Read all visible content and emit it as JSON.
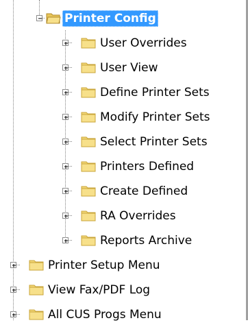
{
  "tree": {
    "selected": {
      "label": "Printer Config",
      "icon": "folder-open-icon",
      "expander": "minus"
    },
    "children": [
      {
        "label": "User Overrides",
        "icon": "folder-icon",
        "expander": "plus"
      },
      {
        "label": "User View",
        "icon": "folder-icon",
        "expander": "plus"
      },
      {
        "label": "Define Printer Sets",
        "icon": "folder-icon",
        "expander": "plus"
      },
      {
        "label": "Modify Printer Sets",
        "icon": "folder-icon",
        "expander": "plus"
      },
      {
        "label": "Select Printer Sets",
        "icon": "folder-icon",
        "expander": "plus"
      },
      {
        "label": "Printers Defined",
        "icon": "folder-icon",
        "expander": "plus"
      },
      {
        "label": "Create Defined",
        "icon": "folder-icon",
        "expander": "plus"
      },
      {
        "label": "RA Overrides",
        "icon": "folder-icon",
        "expander": "plus"
      },
      {
        "label": "Reports Archive",
        "icon": "folder-icon",
        "expander": "plus"
      }
    ],
    "siblings": [
      {
        "label": "Printer Setup Menu",
        "icon": "folder-icon",
        "expander": "plus"
      },
      {
        "label": "View Fax/PDF Log",
        "icon": "folder-icon",
        "expander": "plus"
      },
      {
        "label": "All CUS Progs Menu",
        "icon": "folder-icon",
        "expander": "plus"
      }
    ]
  },
  "colors": {
    "selection_bg": "#3399ff",
    "folder_body": "#f2d675",
    "folder_edge": "#c9a53a"
  }
}
